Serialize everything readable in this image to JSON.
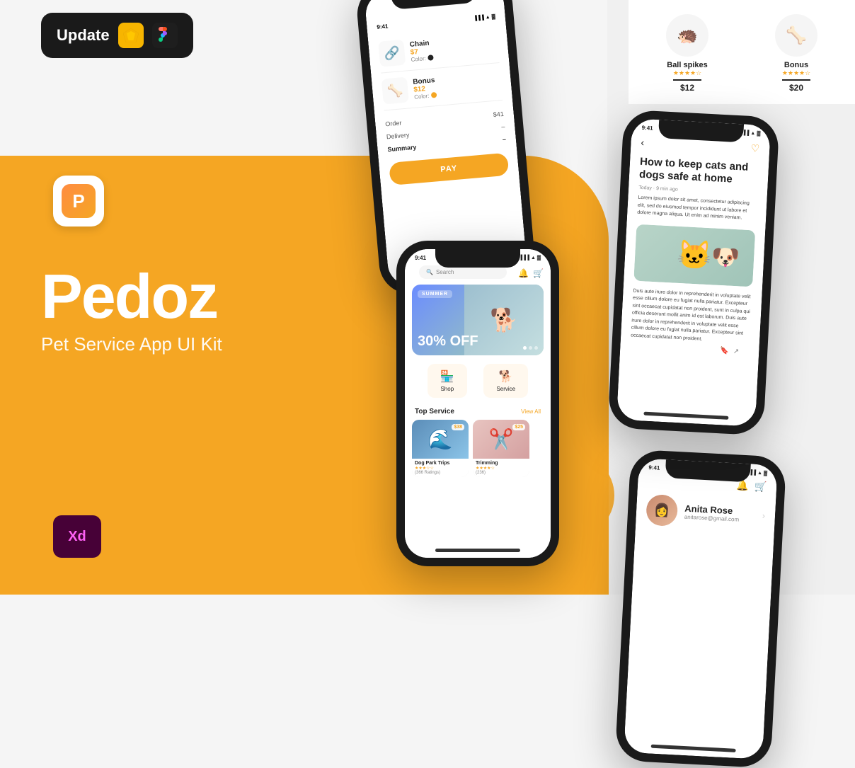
{
  "background": {
    "yellow_color": "#F5A623",
    "dark_color": "#1a1a1a",
    "light_color": "#f5f5f5"
  },
  "update_badge": {
    "label": "Update",
    "sketch_icon": "sketch",
    "figma_icon": "figma"
  },
  "app": {
    "name": "Pedoz",
    "subtitle": "Pet Service App UI Kit",
    "icon_letter": "P"
  },
  "tools": {
    "xd_label": "Xd"
  },
  "phone1_cart": {
    "status_time": "9:41",
    "items": [
      {
        "name": "Chain",
        "price": "$7",
        "color_label": "Color:",
        "color": "black",
        "emoji": "🔗"
      },
      {
        "name": "Bonus",
        "price": "$12",
        "color_label": "Color:",
        "color": "yellow",
        "emoji": "🦴"
      }
    ],
    "order_label": "Order",
    "order_value": "$41",
    "delivery_label": "Delivery",
    "delivery_value": "–",
    "summary_label": "Summary",
    "summary_value": "–",
    "pay_button": "PAY"
  },
  "phone2_home": {
    "status_time": "9:41",
    "search_placeholder": "Search",
    "banner_tag": "SUMMER",
    "banner_title": "30% OFF",
    "nav_shop": "Shop",
    "nav_service": "Service",
    "top_service_label": "Top Service",
    "view_all_label": "View All",
    "service_cards": [
      {
        "name": "Dog Park Trips",
        "price": "$38",
        "rating": "★★★☆☆",
        "rating_count": "(366 Ratings)"
      },
      {
        "name": "Trimming",
        "price": "$25",
        "rating": "★★★★☆",
        "rating_count": "(236)"
      }
    ]
  },
  "phone3_article": {
    "status_time": "9:41",
    "title": "How to keep cats and dogs safe at home",
    "meta": "Today · 9 min ago",
    "body1": "Lorem ipsum dolor sit amet, consectetur adipiscing elit, sed do eiusmod tempor incididunt ut labore et dolore magna aliqua. Ut enim ad minim veniam.",
    "body2": "Duis aute irure dolor in reprehenderit in voluptate velit esse cillum dolore eu fugiat nulla pariatur. Excepteur sint occaecat cupidatat non proident, sunt in culpa qui officia deserunt mollit anim id est laborum. Duis aute irure dolor in reprehenderit in voluptate velit esse cillum dolore eu fugiat nulla pariatur. Excepteur sint occaecat cupidatat non proident."
  },
  "phone4_profile": {
    "status_time": "9:41",
    "user_name": "Anita Rose",
    "user_email": "anitarose@gmail.com"
  },
  "product_display": {
    "items": [
      {
        "name": "Ball spikes",
        "price": "$12",
        "stars": "★★★★☆",
        "emoji": "🦔"
      },
      {
        "name": "Bonus",
        "price": "$20",
        "stars": "★★★★☆",
        "emoji": "🦴"
      }
    ]
  }
}
